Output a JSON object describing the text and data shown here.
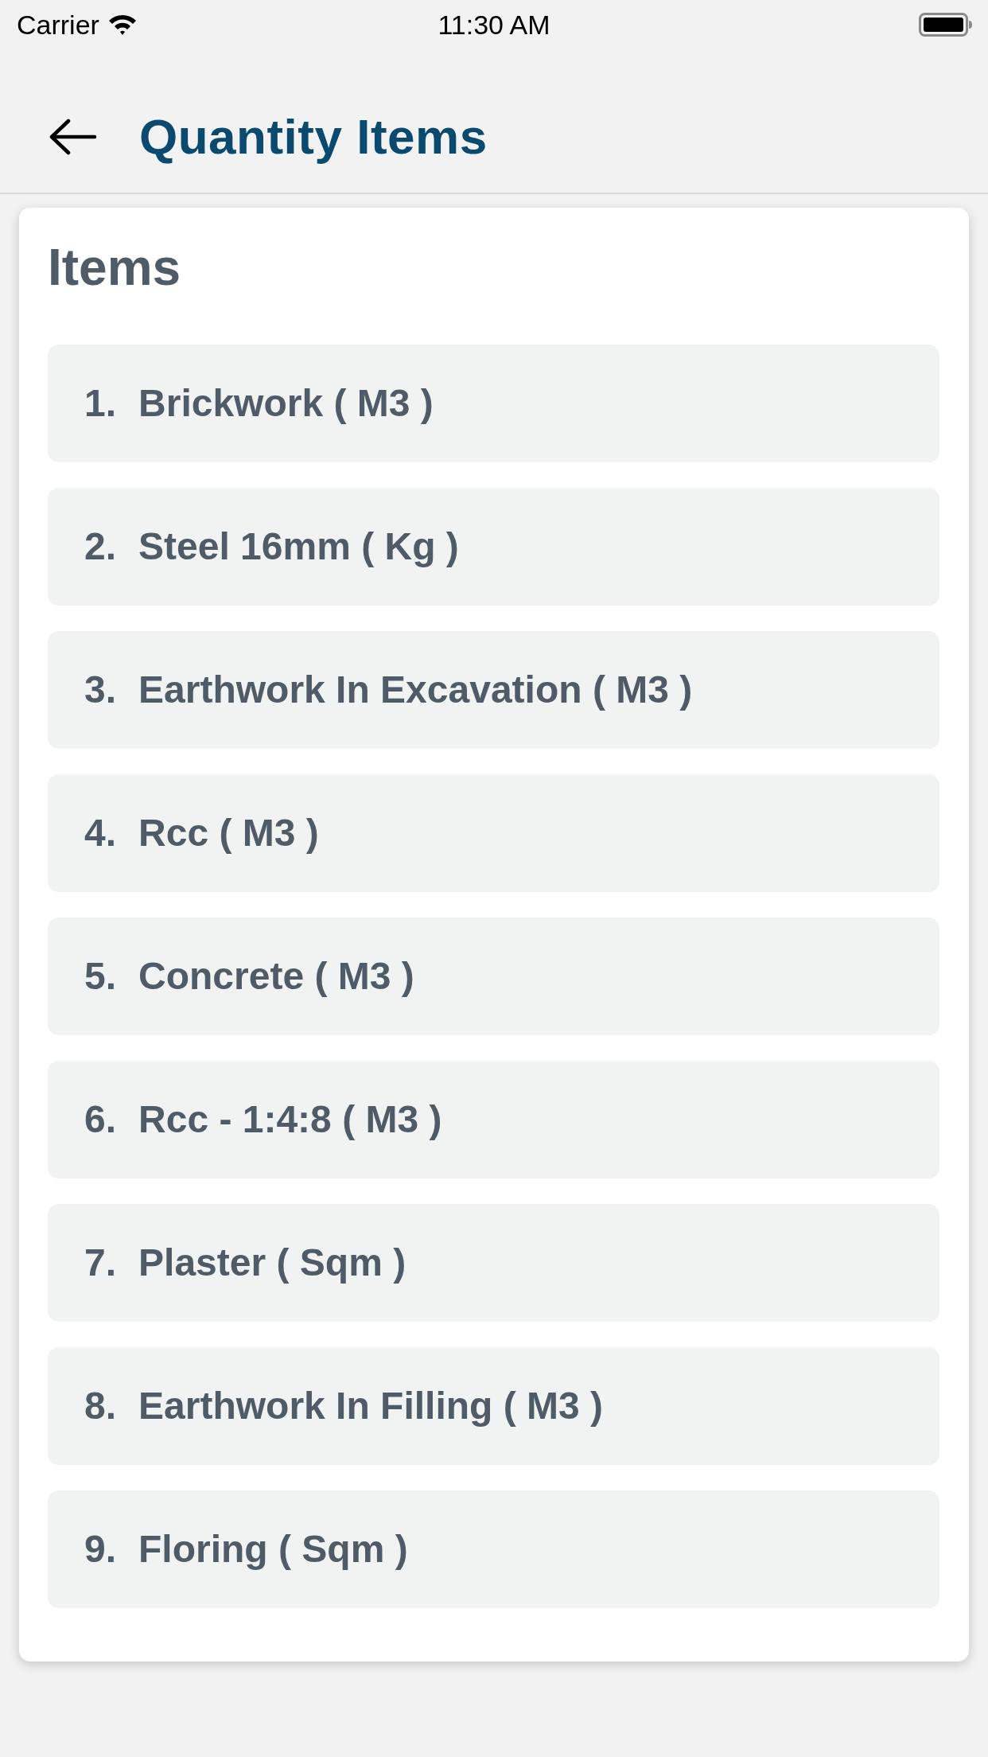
{
  "status_bar": {
    "carrier": "Carrier",
    "time": "11:30 AM"
  },
  "header": {
    "title": "Quantity Items"
  },
  "card": {
    "heading": "Items",
    "items": [
      {
        "number": "1.",
        "name": "Brickwork ( M3 )"
      },
      {
        "number": "2.",
        "name": "Steel 16mm ( Kg )"
      },
      {
        "number": "3.",
        "name": "Earthwork In Excavation ( M3 )"
      },
      {
        "number": "4.",
        "name": "Rcc ( M3 )"
      },
      {
        "number": "5.",
        "name": "Concrete ( M3 )"
      },
      {
        "number": "6.",
        "name": "Rcc - 1:4:8 ( M3 )"
      },
      {
        "number": "7.",
        "name": "Plaster ( Sqm )"
      },
      {
        "number": "8.",
        "name": "Earthwork In Filling ( M3 )"
      },
      {
        "number": "9.",
        "name": "Floring ( Sqm )"
      }
    ]
  }
}
